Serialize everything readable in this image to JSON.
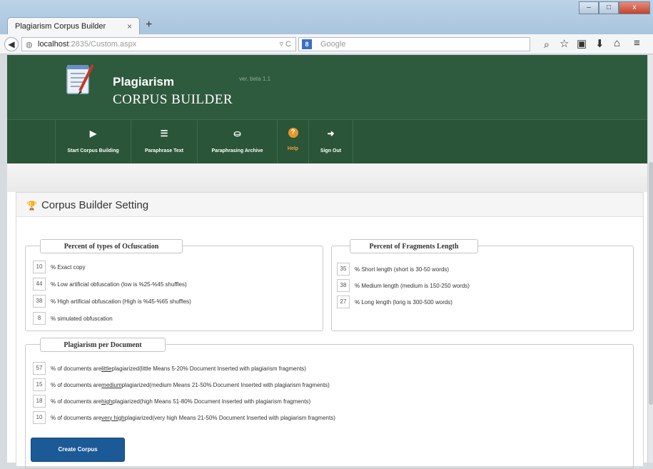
{
  "browser": {
    "tab_title": "Plagiarism Corpus Builder",
    "tab_close": "×",
    "new_tab": "+",
    "window_buttons": [
      "–",
      "□",
      "x"
    ],
    "url_host": "localhost",
    "url_rest": ":2835/Custom.aspx",
    "reload": "▿ C",
    "search_engine_badge": "8",
    "search_placeholder": "Google",
    "back_icon": "back-arrow-icon",
    "toolbar_icons": [
      "search-icon",
      "star-icon",
      "clipboard-icon",
      "download-icon",
      "home-icon",
      "menu-icon"
    ]
  },
  "header": {
    "brand_line1": "Plagiarism",
    "brand_line2": "CORPUS BUILDER",
    "version": "ver. beta 1.1",
    "bg_color": "#2e5a3e"
  },
  "menu": [
    {
      "label": "Start Corpus Building",
      "icon": "play-icon",
      "glyph": "▶"
    },
    {
      "label": "Paraphrase Text",
      "icon": "list-icon",
      "glyph": "☰"
    },
    {
      "label": "Paraphrasing Archive",
      "icon": "inbox-icon",
      "glyph": "⛀"
    },
    {
      "label": "Help",
      "icon": "help-icon",
      "glyph": "?"
    },
    {
      "label": "Sign Out",
      "icon": "sign-out-icon",
      "glyph": "➜"
    }
  ],
  "panel": {
    "title": "Corpus Builder Setting",
    "icon": "trophy-icon"
  },
  "ofuscation": {
    "legend": "Percent of types of Ocfuscation",
    "rows": [
      {
        "value": "10",
        "text": "% Exact copy"
      },
      {
        "value": "44",
        "text": "% Low artificial obfuscation (low is %25-%45 shuffles)"
      },
      {
        "value": "38",
        "text": "% High artificial obfuscation (High is %45-%65 shuffles)"
      },
      {
        "value": "8",
        "text": "% simulated obfuscation"
      }
    ]
  },
  "fragments": {
    "legend": "Percent of Fragments Length",
    "rows": [
      {
        "value": "35",
        "text": "% Short length (short is 30-50 words)"
      },
      {
        "value": "38",
        "text": "% Medium length (medium is 150-250 words)"
      },
      {
        "value": "27",
        "text": "% Long length (long is 300-500 words)"
      }
    ]
  },
  "per_document": {
    "legend": "Plagiarism per Document",
    "rows": [
      {
        "value": "57",
        "prefix": "% of documents are ",
        "key": "little",
        "suffix": " plagiarized(little Means 5-20% Document Inserted with plagiarism fragments)"
      },
      {
        "value": "15",
        "prefix": "% of documents are ",
        "key": "medium",
        "suffix": " plagiarized(medium Means 21-50% Document Inserted with plagiarism fragments)"
      },
      {
        "value": "18",
        "prefix": "% of documents are ",
        "key": "high",
        "suffix": " plagiarized(high Means 51-80% Document Inserted with plagiarism fragments)"
      },
      {
        "value": "10",
        "prefix": "% of documents are ",
        "key": "very high",
        "suffix": " plagiarized(very high Means 21-50% Document Inserted with plagiarism fragments)"
      }
    ]
  },
  "create_button": "Create Corpus"
}
